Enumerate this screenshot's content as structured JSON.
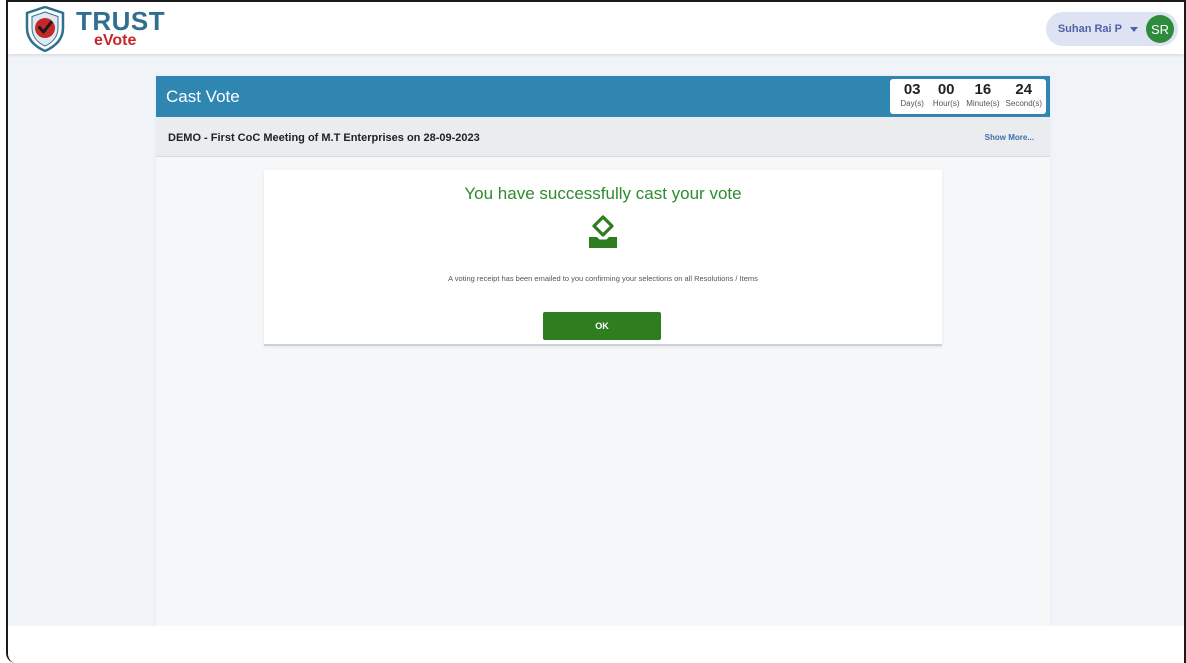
{
  "brand": {
    "name_top": "TRUST",
    "name_bottom": "eVote",
    "colors": {
      "primary": "#2f6f8f",
      "accent": "#c62828"
    }
  },
  "user": {
    "name": "Suhan Rai P",
    "initials": "SR",
    "avatar_color": "#2e8b3a"
  },
  "page": {
    "title": "Cast Vote",
    "header_color": "#2f86b1"
  },
  "countdown": [
    {
      "value": "03",
      "label": "Day(s)"
    },
    {
      "value": "00",
      "label": "Hour(s)"
    },
    {
      "value": "16",
      "label": "Minute(s)"
    },
    {
      "value": "24",
      "label": "Second(s)"
    }
  ],
  "meeting": {
    "title": "DEMO - First CoC Meeting of M.T Enterprises on 28-09-2023",
    "show_more": "Show More..."
  },
  "confirmation": {
    "heading": "You have successfully cast your vote",
    "icon": "ballot-box-icon",
    "receipt_message": "A voting receipt has been emailed to you confirming your selections on all Resolutions / Items",
    "ok_label": "OK",
    "success_color": "#2e8b2e"
  }
}
